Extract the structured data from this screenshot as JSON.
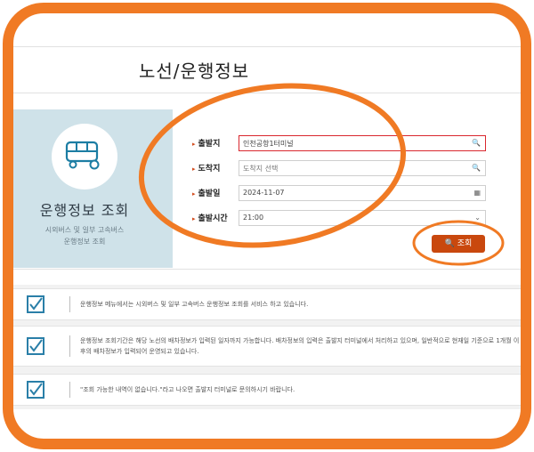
{
  "page_title": "노선/운행정보",
  "left_panel": {
    "icon": "bus-icon",
    "title": "운행정보 조회",
    "subtitle_line1": "시외버스 및 일부 고속버스",
    "subtitle_line2": "운행정보 조회"
  },
  "form": {
    "departure": {
      "label": "출발지",
      "value": "인천공항1터미널",
      "icon": "search-icon"
    },
    "arrival": {
      "label": "도착지",
      "placeholder": "도착지 선택",
      "icon": "search-icon"
    },
    "date": {
      "label": "출발일",
      "value": "2024-11-07",
      "icon": "calendar-icon"
    },
    "time": {
      "label": "출발시간",
      "value": "21:00",
      "icon": "chevron-down-icon"
    },
    "search_button": "조회"
  },
  "notices": [
    {
      "text": "운행정보 메뉴에서는 시외버스 및 일부 고속버스 운행정보 조회를 서비스 하고 있습니다."
    },
    {
      "text": "운행정보 조회기간은 해당 노선의 배차정보가 입력된 일자까지 가능합니다. 배차정보의 입력은 출발지 터미널에서 처리하고 있으며, 일반적으로 현재일 기준으로 1개월 이후의 배차정보가 입력되어 운영되고 있습니다."
    },
    {
      "text": "\"조회 가능한 내역이 없습니다.\"라고 나오면 출발지 터미널로 문의하시기 바랍니다."
    }
  ],
  "colors": {
    "accent_orange": "#f07a24",
    "button": "#c9480e",
    "highlight_red": "#d9272e",
    "panel_bg": "#cfe2e9",
    "check_blue": "#2a7fa8"
  }
}
